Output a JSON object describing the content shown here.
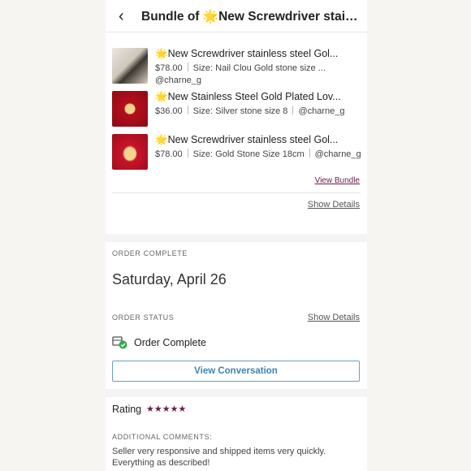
{
  "header": {
    "back_icon": "chevron-left-icon",
    "title": "Bundle of 🌟New Screwdriver stainless steel Gold..."
  },
  "bundle": {
    "items": [
      {
        "name": "🌟New Screwdriver stainless steel Gol...",
        "price": "$78.00",
        "size": "Size: Nail Clou Gold stone size ...",
        "seller": "@charne_g"
      },
      {
        "name": "🌟New Stainless Steel Gold Plated Lov...",
        "price": "$36.00",
        "size": "Size: Silver stone size 8",
        "seller": "@charne_g"
      },
      {
        "name": "🌟New Screwdriver stainless steel Gol...",
        "price": "$78.00",
        "size": "Size: Gold Stone Size 18cm",
        "seller": "@charne_g"
      }
    ],
    "view_bundle": "View Bundle",
    "show_details": "Show Details"
  },
  "order": {
    "complete_label": "ORDER COMPLETE",
    "date": "Saturday, April 26",
    "status_label": "ORDER STATUS",
    "status_show_details": "Show Details",
    "status_text": "Order Complete",
    "view_conversation": "View Conversation"
  },
  "rating": {
    "label": "Rating",
    "stars": 5,
    "stars_text": "★★★★★",
    "comments_label": "ADDITIONAL COMMENTS:",
    "comment": "Seller very responsive and shipped items very quickly. Everything as described!"
  },
  "colors": {
    "accent": "#6a1b4d",
    "button_text": "#3f82b3",
    "status_green": "#2ea84a"
  }
}
